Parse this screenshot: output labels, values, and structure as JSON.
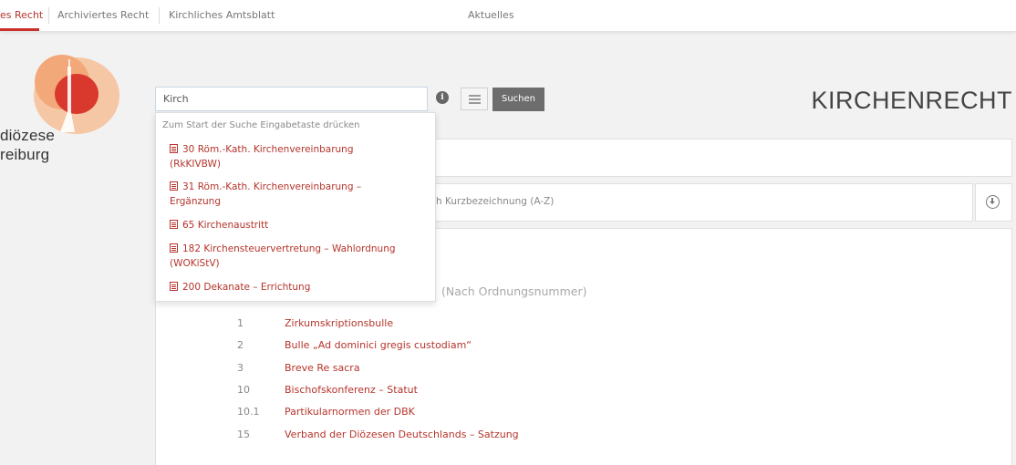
{
  "topnav": {
    "items": [
      {
        "label": "es Recht",
        "active": true
      },
      {
        "label": "Archiviertes Recht",
        "active": false
      },
      {
        "label": "Kirchliches Amtsblatt",
        "active": false
      },
      {
        "label": "Aktuelles",
        "active": false
      }
    ]
  },
  "logo": {
    "line1": "diözese",
    "line2": "reiburg"
  },
  "search": {
    "value": "Kirch",
    "info_icon": "info-icon",
    "list_icon": "list-icon",
    "button_label": "Suchen"
  },
  "page_title": "KIRCHENRECHT",
  "sort": {
    "label": "h Kurzbezeichnung (A-Z)",
    "download_icon": "download-icon"
  },
  "list": {
    "heading": "(Nach Ordnungsnummer)",
    "rows": [
      {
        "num": "1",
        "title": "Zirkumskriptionsbulle"
      },
      {
        "num": "2",
        "title": "Bulle „Ad dominici gregis custodiam“"
      },
      {
        "num": "3",
        "title": "Breve Re sacra"
      },
      {
        "num": "10",
        "title": "Bischofskonferenz – Statut"
      },
      {
        "num": "10.1",
        "title": "Partikularnormen der DBK"
      },
      {
        "num": "15",
        "title": "Verband der Diözesen Deutschlands – Satzung"
      }
    ]
  },
  "dropdown": {
    "hint": "Zum Start der Suche Eingabetaste drücken",
    "items": [
      {
        "line1": "30 Röm.-Kath. Kirchenvereinbarung",
        "line2": "(RkKIVBW)"
      },
      {
        "line1": "31 Röm.-Kath. Kirchenvereinbarung –",
        "line2": "Ergänzung"
      },
      {
        "line1": "65 Kirchenaustritt",
        "line2": ""
      },
      {
        "line1": "182 Kirchensteuervertretung – Wahlordnung",
        "line2": "(WOKiStV)"
      },
      {
        "line1": "200 Dekanate – Errichtung",
        "line2": ""
      }
    ]
  },
  "colors": {
    "accent": "#c9302c",
    "link": "#b5342b",
    "logo_orange": "#f0a070",
    "logo_red": "#d9382d",
    "button_gray": "#6d6d6d"
  }
}
